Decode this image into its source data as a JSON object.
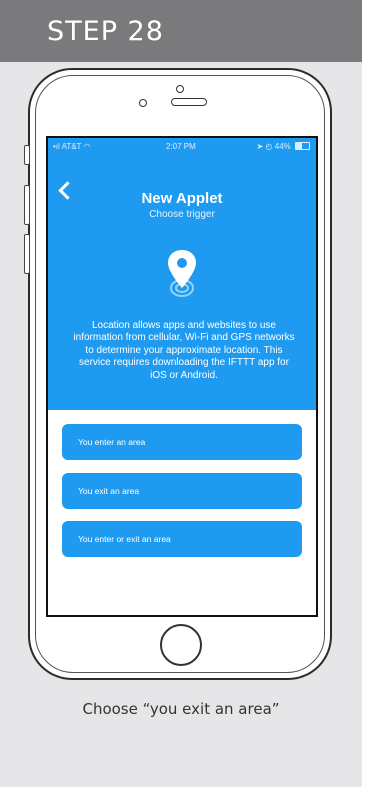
{
  "step": {
    "title": "STEP 28"
  },
  "status_bar": {
    "carrier": "AT&T",
    "time": "2:07 PM",
    "battery": "44%"
  },
  "screen": {
    "title": "New Applet",
    "subtitle": "Choose trigger",
    "icon": "location-pin-icon",
    "description": "Location allows apps and websites to use information from cellular, Wi-Fi and GPS networks to determine your approximate location. This service requires downloading the IFTTT app for iOS or Android.",
    "options": [
      {
        "label": "You enter an area"
      },
      {
        "label": "You exit an area"
      },
      {
        "label": "You enter or exit an area"
      }
    ]
  },
  "caption": "Choose “you exit an area”",
  "colors": {
    "header_gray": "#7a7a7c",
    "background_gray": "#e6e6e8",
    "ifttt_blue": "#1e9bf0"
  }
}
